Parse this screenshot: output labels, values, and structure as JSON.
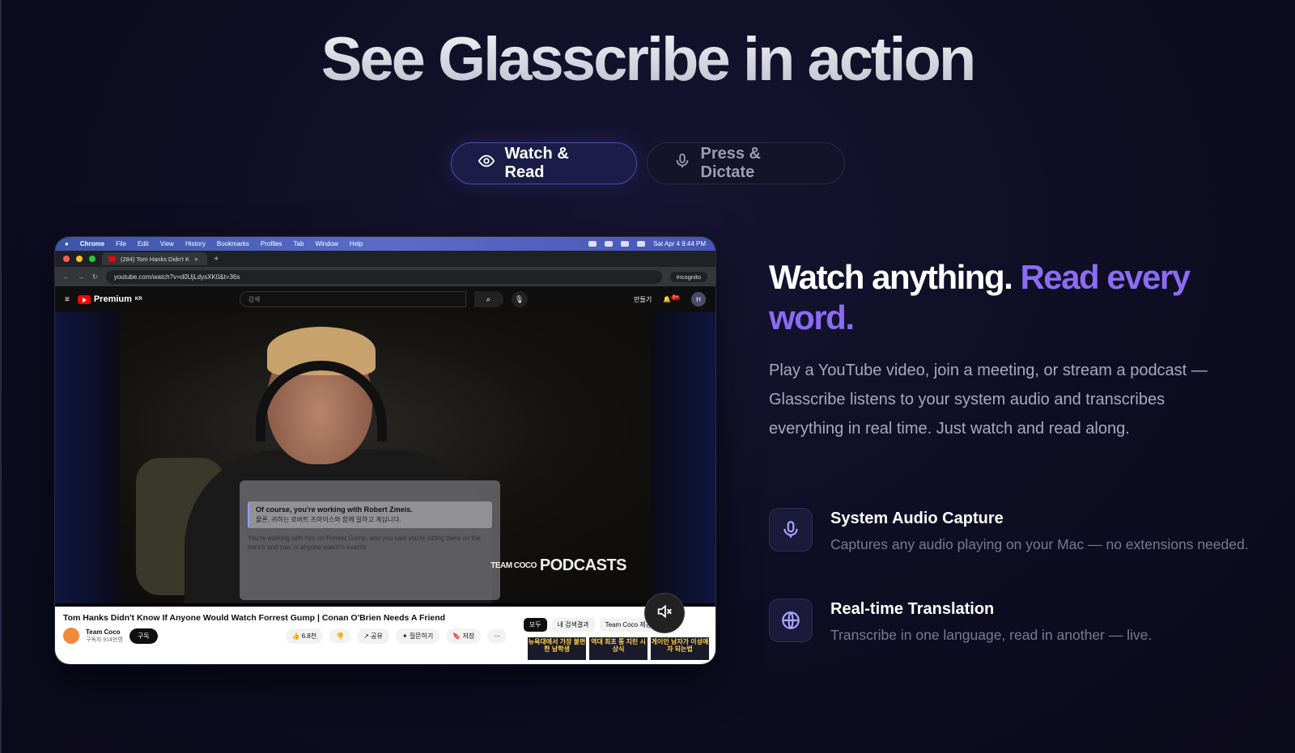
{
  "hero": {
    "title": "See Glasscribe in action"
  },
  "tabs": [
    {
      "label": "Watch & Read",
      "icon": "eye-icon",
      "active": true
    },
    {
      "label": "Press & Dictate",
      "icon": "mic-icon",
      "active": false
    }
  ],
  "screenshot": {
    "mac_menu": {
      "app": "Chrome",
      "items": [
        "File",
        "Edit",
        "View",
        "History",
        "Bookmarks",
        "Profiles",
        "Tab",
        "Window",
        "Help"
      ],
      "clock": "Sat Apr 4  9:44 PM"
    },
    "browser": {
      "tab_title": "(284) Tom Hanks Didn't K",
      "url": "youtube.com/watch?v=d0UjLdysXK0&t=36s",
      "incognito_label": "Incognito"
    },
    "youtube": {
      "logo": "Premium",
      "logo_badge": "KR",
      "search_placeholder": "검색",
      "create_label": "만들기",
      "notif_count": "9+",
      "avatar_letter": "H",
      "video_title": "Tom Hanks Didn't Know If Anyone Would Watch Forrest Gump | Conan O'Brien Needs A Friend",
      "channel": "Team Coco",
      "subscribers": "구독자 914만명",
      "subscribe_label": "구독",
      "likes": "6.8천",
      "share": "공유",
      "ask": "질문하기",
      "save": "저장",
      "chips": [
        "모두",
        "내 검색결과",
        "Team Coco 제공"
      ],
      "thumbs": [
        "뉴욕대에서 가장 불편한 남학생",
        "역대 최초 통 지린 시상식",
        "게이인 남자가 이성애자 되는법"
      ]
    },
    "overlay": {
      "original": "Of course, you're working with Robert Zmeis.",
      "translation": "물론, 귀하는 로버트 즈마이스와 함께 일하고 계십니다.",
      "next": "You're working with him on Forrest Gump, and you said you're sitting there on the bench and you, is anyone watch's exactly"
    },
    "brand": {
      "small": "TEAM COCO",
      "big": "PODCASTS"
    }
  },
  "section": {
    "headline_plain": "Watch anything.",
    "headline_accent": "Read every word.",
    "description": "Play a YouTube video, join a meeting, or stream a podcast — Glasscribe listens to your system audio and transcribes everything in real time. Just watch and read along."
  },
  "features": [
    {
      "icon": "mic-icon",
      "title": "System Audio Capture",
      "text": "Captures any audio playing on your Mac — no extensions needed."
    },
    {
      "icon": "globe-icon",
      "title": "Real-time Translation",
      "text": "Transcribe in one language, read in another — live."
    }
  ],
  "colors": {
    "accent": "#8b6cf2",
    "background": "#0e0d22",
    "tab_active_border": "#4b4fb0"
  }
}
